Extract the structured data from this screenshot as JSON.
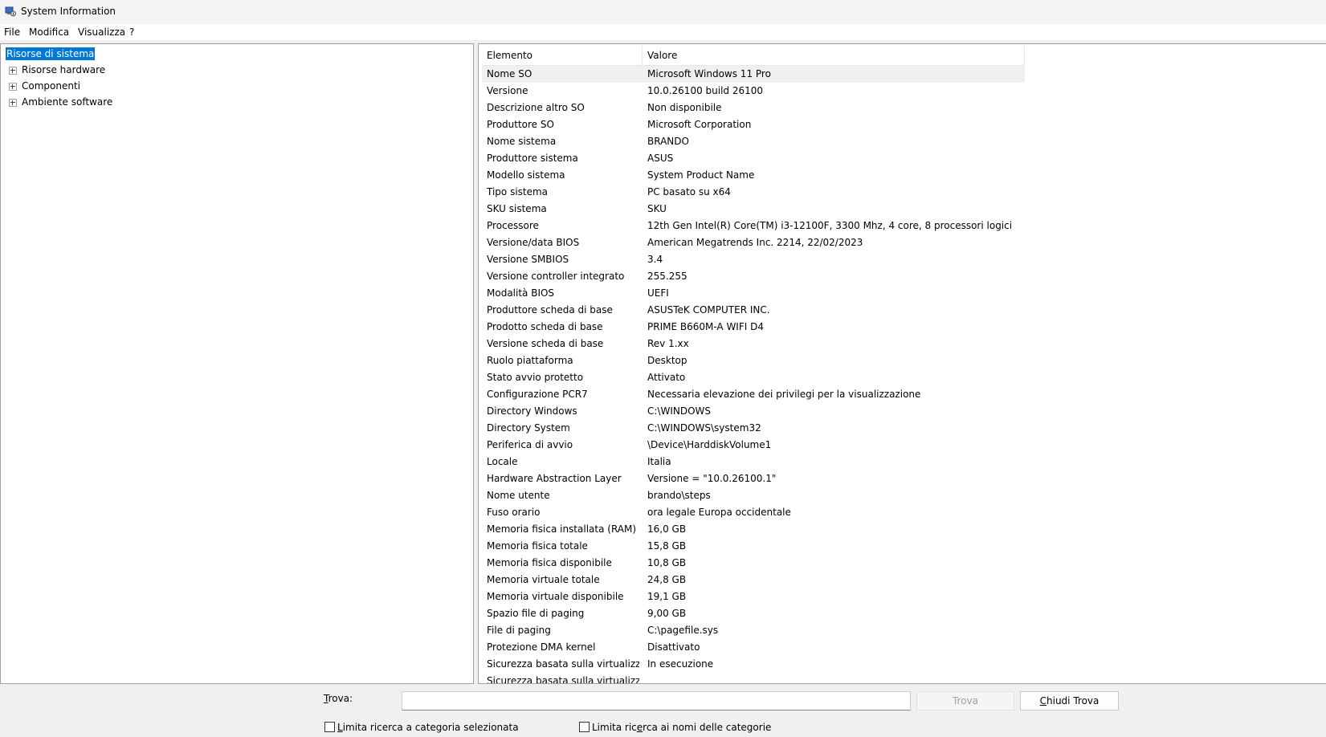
{
  "window": {
    "title": "System Information",
    "icon": "system-info-icon"
  },
  "menu": {
    "items": [
      "File",
      "Modifica",
      "Visualizza",
      "?"
    ]
  },
  "tree": {
    "root": "Risorse di sistema",
    "children": [
      "Risorse hardware",
      "Componenti",
      "Ambiente software"
    ]
  },
  "table": {
    "headers": [
      "Elemento",
      "Valore"
    ],
    "rows": [
      [
        "Nome SO",
        "Microsoft Windows 11 Pro"
      ],
      [
        "Versione",
        "10.0.26100 build 26100"
      ],
      [
        "Descrizione altro SO",
        "Non disponibile"
      ],
      [
        "Produttore SO",
        "Microsoft Corporation"
      ],
      [
        "Nome sistema",
        "BRANDO"
      ],
      [
        "Produttore sistema",
        "ASUS"
      ],
      [
        "Modello sistema",
        "System Product Name"
      ],
      [
        "Tipo sistema",
        "PC basato su x64"
      ],
      [
        "SKU sistema",
        "SKU"
      ],
      [
        "Processore",
        "12th Gen Intel(R) Core(TM) i3-12100F, 3300 Mhz, 4 core, 8 processori logici"
      ],
      [
        "Versione/data BIOS",
        "American Megatrends Inc. 2214, 22/02/2023"
      ],
      [
        "Versione SMBIOS",
        "3.4"
      ],
      [
        "Versione controller integrato",
        "255.255"
      ],
      [
        "Modalità BIOS",
        "UEFI"
      ],
      [
        "Produttore scheda di base",
        "ASUSTeK COMPUTER INC."
      ],
      [
        "Prodotto scheda di base",
        "PRIME B660M-A WIFI D4"
      ],
      [
        "Versione scheda di base",
        "Rev 1.xx"
      ],
      [
        "Ruolo piattaforma",
        "Desktop"
      ],
      [
        "Stato avvio protetto",
        "Attivato"
      ],
      [
        "Configurazione PCR7",
        "Necessaria elevazione dei privilegi per la visualizzazione"
      ],
      [
        "Directory Windows",
        "C:\\WINDOWS"
      ],
      [
        "Directory System",
        "C:\\WINDOWS\\system32"
      ],
      [
        "Periferica di avvio",
        "\\Device\\HarddiskVolume1"
      ],
      [
        "Locale",
        "Italia"
      ],
      [
        "Hardware Abstraction Layer",
        "Versione = \"10.0.26100.1\""
      ],
      [
        "Nome utente",
        "brando\\steps"
      ],
      [
        "Fuso orario",
        "ora legale Europa occidentale"
      ],
      [
        "Memoria fisica installata (RAM)",
        "16,0 GB"
      ],
      [
        "Memoria fisica totale",
        "15,8 GB"
      ],
      [
        "Memoria fisica disponibile",
        "10,8 GB"
      ],
      [
        "Memoria virtuale totale",
        "24,8 GB"
      ],
      [
        "Memoria virtuale disponibile",
        "19,1 GB"
      ],
      [
        "Spazio file di paging",
        "9,00 GB"
      ],
      [
        "File di paging",
        "C:\\pagefile.sys"
      ],
      [
        "Protezione DMA kernel",
        "Disattivato"
      ],
      [
        "Sicurezza basata sulla virtualizz...",
        "In esecuzione"
      ],
      [
        "Sicurezza basata sulla virtualizz...",
        ""
      ]
    ]
  },
  "find": {
    "label": "Trova:",
    "value": "",
    "find_button": "Trova",
    "close_button": "Chiudi Trova",
    "limit_selected": "Limita ricerca a categoria selezionata",
    "limit_names": "Limita ricerca ai nomi delle categorie"
  }
}
